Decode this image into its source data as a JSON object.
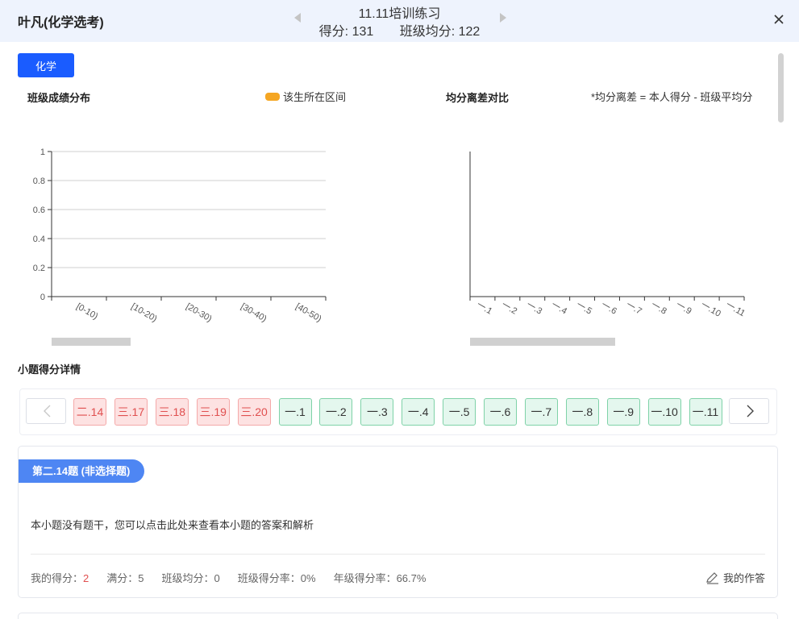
{
  "header": {
    "student_name": "叶凡(化学选考)",
    "exam_title": "11.11培训练习",
    "score_label": "得分: 131",
    "class_avg_label": "班级均分: 122"
  },
  "subject_tab": "化学",
  "distribution": {
    "title": "班级成绩分布",
    "legend": "该生所在区间"
  },
  "deviation": {
    "title": "均分离差对比",
    "note": "*均分离差 = 本人得分 - 班级平均分"
  },
  "chart_data": [
    {
      "type": "bar",
      "title": "班级成绩分布",
      "categories": [
        "[0-10)",
        "[10-20)",
        "[20-30)",
        "[30-40)",
        "[40-50)"
      ],
      "values": [
        0,
        0,
        0,
        0,
        0
      ],
      "yticks": [
        "0",
        "0.2",
        "0.4",
        "0.6",
        "0.8",
        "1"
      ],
      "ylim": [
        0,
        1
      ],
      "grid": true,
      "legend": "top-right"
    },
    {
      "type": "bar",
      "title": "均分离差对比",
      "categories": [
        "一.1",
        "一.2",
        "一.3",
        "一.4",
        "一.5",
        "一.6",
        "一.7",
        "一.8",
        "一.9",
        "一.10",
        "一.11"
      ],
      "values": [],
      "grid": false
    }
  ],
  "detail_title": "小题得分详情",
  "questions": [
    {
      "label": "二.14",
      "status": "wrong"
    },
    {
      "label": "三.17",
      "status": "wrong"
    },
    {
      "label": "三.18",
      "status": "wrong"
    },
    {
      "label": "三.19",
      "status": "wrong"
    },
    {
      "label": "三.20",
      "status": "wrong"
    },
    {
      "label": "一.1",
      "status": "right"
    },
    {
      "label": "一.2",
      "status": "right"
    },
    {
      "label": "一.3",
      "status": "right"
    },
    {
      "label": "一.4",
      "status": "right"
    },
    {
      "label": "一.5",
      "status": "right"
    },
    {
      "label": "一.6",
      "status": "right"
    },
    {
      "label": "一.7",
      "status": "right"
    },
    {
      "label": "一.8",
      "status": "right"
    },
    {
      "label": "一.9",
      "status": "right"
    },
    {
      "label": "一.10",
      "status": "right"
    },
    {
      "label": "一.11",
      "status": "right"
    }
  ],
  "card": {
    "question_label": "第二.14题 (非选择题)",
    "notice": "本小题没有题干，您可以点击此处来查看本小题的答案和解析",
    "stats": {
      "my_score_label": "我的得分：",
      "my_score": "2",
      "full_label": "满分：",
      "full": "5",
      "class_avg_label": "班级均分：",
      "class_avg": "0",
      "class_rate_label": "班级得分率：",
      "class_rate": "0%",
      "grade_rate_label": "年级得分率：",
      "grade_rate": "66.7%"
    },
    "my_answer": "我的作答"
  },
  "colors": {
    "accent": "#1a5cff",
    "label_blue": "#4e86f3",
    "highlight": "#f5a623",
    "wrong": "#e04f4f",
    "right": "#7fd2a8"
  }
}
